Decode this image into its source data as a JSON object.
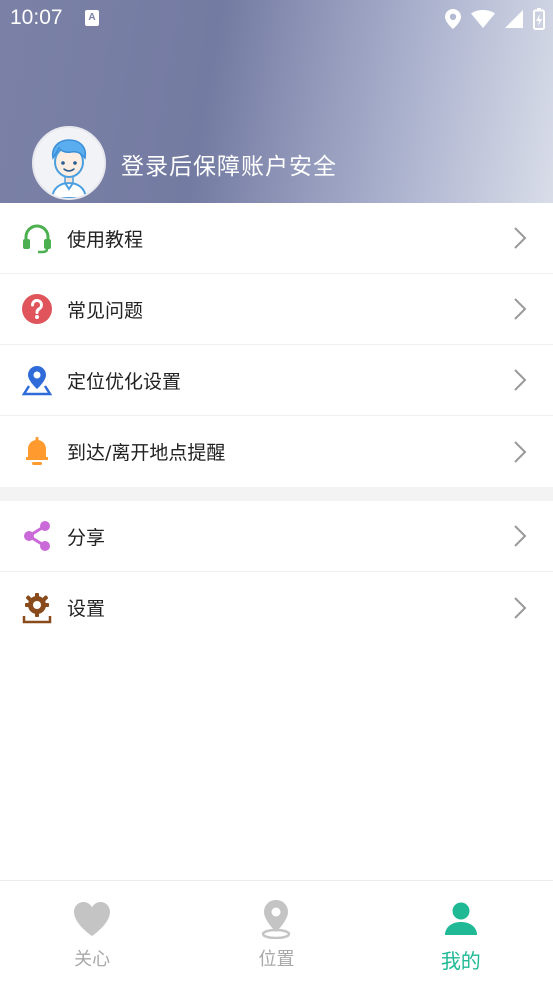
{
  "status_bar": {
    "time": "10:07",
    "left_icon_letter": "A",
    "icons": [
      "location-icon",
      "wifi-icon",
      "signal-icon",
      "battery-charging-icon"
    ]
  },
  "profile": {
    "login_prompt": "登录后保障账户安全",
    "avatar_icon": "cartoon-avatar-icon"
  },
  "menu": {
    "group1": [
      {
        "id": "tutorial",
        "label": "使用教程",
        "icon": "headset-icon",
        "color": "#4caf50"
      },
      {
        "id": "faq",
        "label": "常见问题",
        "icon": "question-icon",
        "color": "#e0555b"
      },
      {
        "id": "location-opt",
        "label": "定位优化设置",
        "icon": "map-pin-icon",
        "color": "#2f6bd9"
      },
      {
        "id": "arrive-leave",
        "label": "到达/离开地点提醒",
        "icon": "bell-icon",
        "color": "#ff9a2e"
      }
    ],
    "group2": [
      {
        "id": "share",
        "label": "分享",
        "icon": "share-icon",
        "color": "#c96ad8"
      },
      {
        "id": "settings",
        "label": "设置",
        "icon": "gear-icon",
        "color": "#8a4b1c"
      }
    ]
  },
  "tabbar": {
    "tabs": [
      {
        "id": "care",
        "label": "关心",
        "icon": "heart-icon",
        "active": false
      },
      {
        "id": "location",
        "label": "位置",
        "icon": "location-pin-icon",
        "active": false
      },
      {
        "id": "mine",
        "label": "我的",
        "icon": "person-icon",
        "active": true
      }
    ],
    "active_color": "#1fb995",
    "inactive_color": "#a9a9a9"
  }
}
